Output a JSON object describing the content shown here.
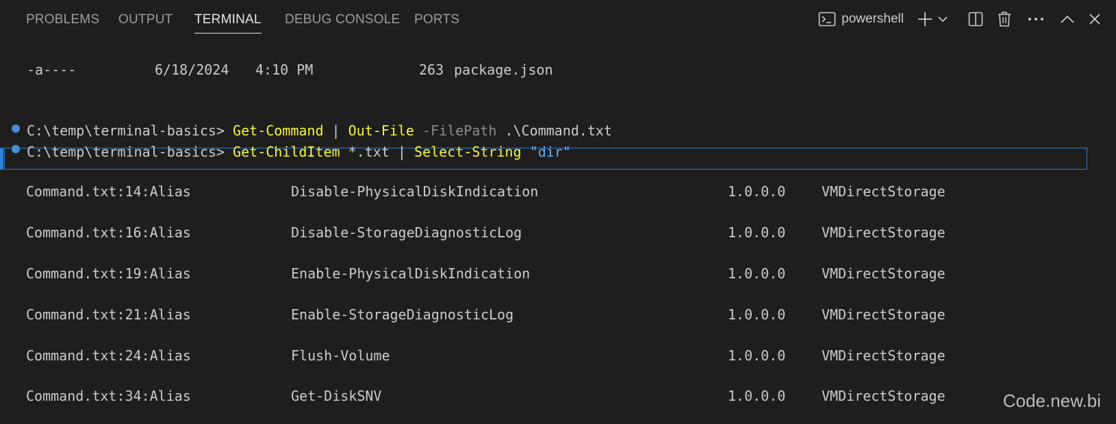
{
  "tabs": {
    "problems": "PROBLEMS",
    "output": "OUTPUT",
    "terminal": "TERMINAL",
    "debug_console": "DEBUG CONSOLE",
    "ports": "PORTS",
    "active": "TERMINAL"
  },
  "toolbar": {
    "shell_name": "powershell",
    "icons": [
      "terminal-shell-icon",
      "plus-icon",
      "chevron-down-icon",
      "split-icon",
      "trash-icon",
      "more-icon",
      "chevron-up-icon",
      "close-icon"
    ]
  },
  "terminal": {
    "file_listing": {
      "mode": "-a----",
      "date": "6/18/2024",
      "time": "4:10 PM",
      "size": "263",
      "name": "package.json"
    },
    "commands": [
      {
        "prompt": "C:\\temp\\terminal-basics>",
        "tokens": [
          {
            "text": "Get-Command",
            "kind": "cmdlet"
          },
          {
            "text": "|",
            "kind": "plain"
          },
          {
            "text": "Out-File",
            "kind": "cmdlet"
          },
          {
            "text": "-FilePath",
            "kind": "param"
          },
          {
            "text": ".\\Command.txt",
            "kind": "plain"
          }
        ]
      },
      {
        "prompt": "C:\\temp\\terminal-basics>",
        "tokens": [
          {
            "text": "Get-ChildItem",
            "kind": "cmdlet"
          },
          {
            "text": "*.txt",
            "kind": "plain"
          },
          {
            "text": "|",
            "kind": "plain"
          },
          {
            "text": "Select-String",
            "kind": "cmdlet"
          },
          {
            "text": "\"dir\"",
            "kind": "string"
          }
        ]
      }
    ],
    "results": [
      {
        "match": "Command.txt:14:Alias",
        "name": "Disable-PhysicalDiskIndication",
        "version": "1.0.0.0",
        "module": "VMDirectStorage"
      },
      {
        "match": "Command.txt:16:Alias",
        "name": "Disable-StorageDiagnosticLog",
        "version": "1.0.0.0",
        "module": "VMDirectStorage"
      },
      {
        "match": "Command.txt:19:Alias",
        "name": "Enable-PhysicalDiskIndication",
        "version": "1.0.0.0",
        "module": "VMDirectStorage"
      },
      {
        "match": "Command.txt:21:Alias",
        "name": "Enable-StorageDiagnosticLog",
        "version": "1.0.0.0",
        "module": "VMDirectStorage"
      },
      {
        "match": "Command.txt:24:Alias",
        "name": "Flush-Volume",
        "version": "1.0.0.0",
        "module": "VMDirectStorage"
      },
      {
        "match": "Command.txt:34:Alias",
        "name": "Get-DiskSNV",
        "version": "1.0.0.0",
        "module": "VMDirectStorage"
      }
    ]
  },
  "colors": {
    "background": "#1e1e1e",
    "cmdlet": "#f5f543",
    "param": "#8c8c8c",
    "string": "#5fb0ff",
    "decoration_dot": "#4a8fd6",
    "selection_border": "#2f7fd1"
  },
  "watermark": "Code.new.bi"
}
